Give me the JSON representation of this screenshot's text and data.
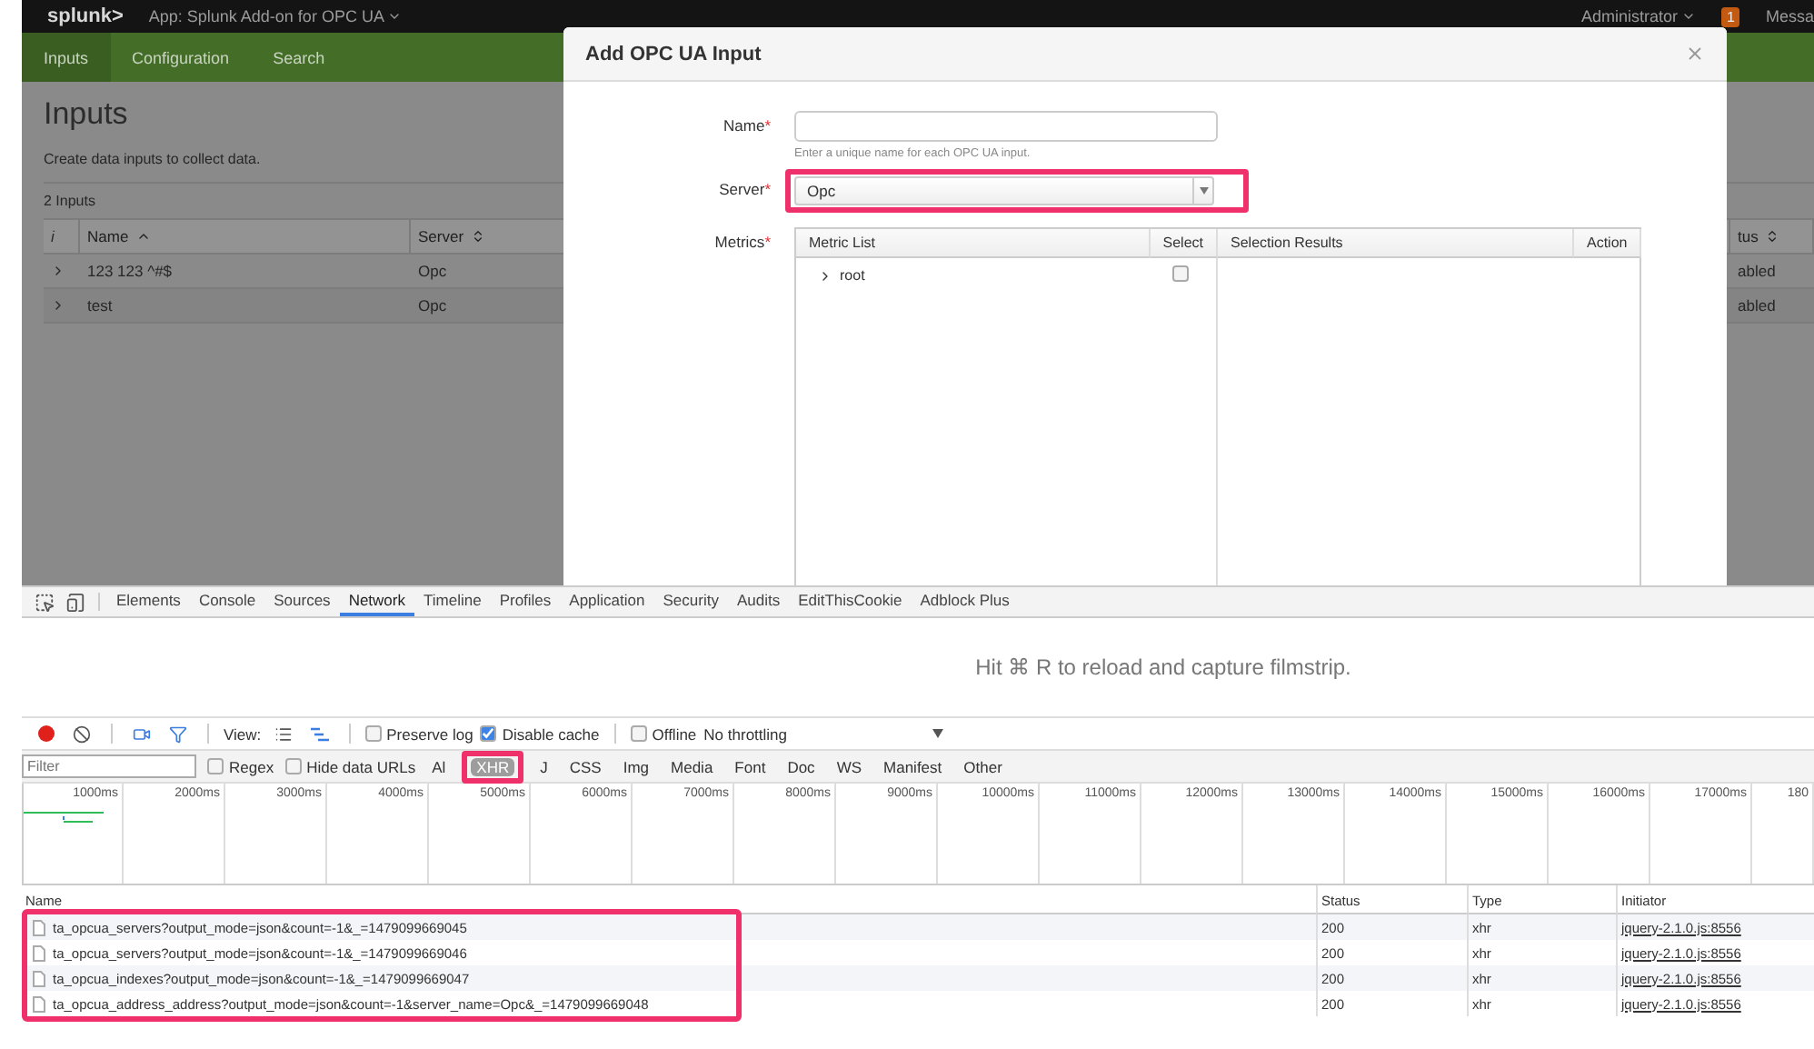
{
  "splunk_bar": {
    "logo": "splunk>",
    "app_menu": "App: Splunk Add-on for OPC UA",
    "user_menu": "Administrator",
    "message_count": "1",
    "messages": "Messa"
  },
  "app_nav": [
    {
      "label": "Inputs",
      "selected": true
    },
    {
      "label": "Configuration",
      "selected": false
    },
    {
      "label": "Search",
      "selected": false
    }
  ],
  "page": {
    "title": "Inputs",
    "description": "Create data inputs to collect data.",
    "count": "2 Inputs",
    "table": {
      "columns": [
        {
          "label": "i",
          "sortable": false,
          "sorted": false
        },
        {
          "label": "Name",
          "sortable": true,
          "sorted": true
        },
        {
          "label": "Server",
          "sortable": true,
          "sorted": false
        },
        {
          "label": "tus",
          "sortable": true,
          "sorted": false
        }
      ],
      "rows": [
        {
          "expanded": false,
          "cells": [
            "",
            "123 123 ^#$",
            "Opc",
            "abled"
          ]
        },
        {
          "expanded": false,
          "cells": [
            "",
            "test",
            "Opc",
            "abled"
          ]
        }
      ]
    }
  },
  "modal": {
    "title": "Add OPC UA Input",
    "fields": [
      {
        "kind": "text",
        "label": "Name",
        "mark": "*",
        "help": "Enter a unique name for each OPC UA input."
      },
      {
        "kind": "select",
        "label": "Server",
        "mark": "*",
        "value": "Opc",
        "highlighted": true
      },
      {
        "kind": "metrics",
        "label": "Metrics",
        "mark": "*",
        "columns": [
          "Metric List",
          "Select",
          "Selection Results",
          "Action"
        ],
        "tree": [
          {
            "label": "root",
            "expanded": false,
            "checked": false
          }
        ]
      }
    ]
  },
  "devtools": {
    "tabs": [
      {
        "label": "Elements",
        "selected": false
      },
      {
        "label": "Console",
        "selected": false
      },
      {
        "label": "Sources",
        "selected": false
      },
      {
        "label": "Network",
        "selected": true
      },
      {
        "label": "Timeline",
        "selected": false
      },
      {
        "label": "Profiles",
        "selected": false
      },
      {
        "label": "Application",
        "selected": false
      },
      {
        "label": "Security",
        "selected": false
      },
      {
        "label": "Audits",
        "selected": false
      },
      {
        "label": "EditThisCookie",
        "selected": false
      },
      {
        "label": "Adblock Plus",
        "selected": false
      }
    ],
    "filmstrip_hint": "Hit ⌘ R to reload and capture filmstrip.",
    "toolbar": {
      "recording": true,
      "view_label": "View:",
      "options": [
        {
          "label": "Preserve log",
          "checked": false
        },
        {
          "label": "Disable cache",
          "checked": true
        }
      ],
      "network_options": [
        {
          "label": "Offline",
          "checked": false
        }
      ],
      "throttling": "No throttling"
    },
    "filter": {
      "placeholder": "Filter",
      "options": [
        {
          "label": "Regex",
          "checked": false
        },
        {
          "label": "Hide data URLs",
          "checked": false
        }
      ],
      "types": [
        {
          "label": "Al",
          "selected": false,
          "highlighted": false
        },
        {
          "label": "XHR",
          "selected": true,
          "highlighted": true
        },
        {
          "label": "J",
          "selected": false,
          "highlighted": false
        },
        {
          "label": "CSS",
          "selected": false,
          "highlighted": false
        },
        {
          "label": "Img",
          "selected": false,
          "highlighted": false
        },
        {
          "label": "Media",
          "selected": false,
          "highlighted": false
        },
        {
          "label": "Font",
          "selected": false,
          "highlighted": false
        },
        {
          "label": "Doc",
          "selected": false,
          "highlighted": false
        },
        {
          "label": "WS",
          "selected": false,
          "highlighted": false
        },
        {
          "label": "Manifest",
          "selected": false,
          "highlighted": false
        },
        {
          "label": "Other",
          "selected": false,
          "highlighted": false
        }
      ]
    },
    "timeline_ticks": [
      "1000ms",
      "2000ms",
      "3000ms",
      "4000ms",
      "5000ms",
      "6000ms",
      "7000ms",
      "8000ms",
      "9000ms",
      "10000ms",
      "11000ms",
      "12000ms",
      "13000ms",
      "14000ms",
      "15000ms",
      "16000ms",
      "17000ms",
      "180"
    ],
    "requests": {
      "columns": [
        "Name",
        "Status",
        "Type",
        "Initiator"
      ],
      "rows": [
        {
          "name": "ta_opcua_servers?output_mode=json&count=-1&_=1479099669045",
          "status": "200",
          "type": "xhr",
          "initiator": "jquery-2.1.0.js:8556",
          "highlighted": true
        },
        {
          "name": "ta_opcua_servers?output_mode=json&count=-1&_=1479099669046",
          "status": "200",
          "type": "xhr",
          "initiator": "jquery-2.1.0.js:8556",
          "highlighted": true
        },
        {
          "name": "ta_opcua_indexes?output_mode=json&count=-1&_=1479099669047",
          "status": "200",
          "type": "xhr",
          "initiator": "jquery-2.1.0.js:8556",
          "highlighted": true
        },
        {
          "name": "ta_opcua_address_address?output_mode=json&count=-1&server_name=Opc&_=1479099669048",
          "status": "200",
          "type": "xhr",
          "initiator": "jquery-2.1.0.js:8556",
          "highlighted": true
        }
      ]
    }
  }
}
